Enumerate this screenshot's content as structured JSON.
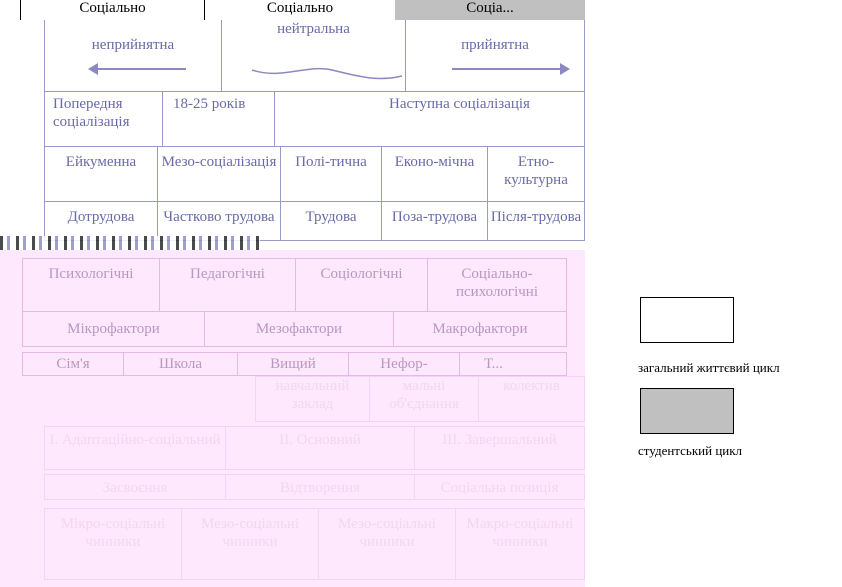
{
  "header": {
    "col1": "Соціально",
    "col2": "Соціально",
    "col3": "Соціа..."
  },
  "row_stance": [
    "неприйнятна",
    "нейтральна",
    "прийнятна"
  ],
  "row_age": {
    "previous": "Попередня соціалізація",
    "age": "18-25 років",
    "next": "Наступна соціалізація"
  },
  "row_types": [
    "Ейкуменна",
    "Мезо-соціалізація",
    "Полі-тична",
    "Еконо-мічна",
    "Етно-культурна"
  ],
  "row_work": [
    "Дотрудова",
    "Частково трудова",
    "Трудова",
    "Поза-трудова",
    "Після-трудова"
  ],
  "row_approaches": [
    "Психологічні",
    "Педагогічні",
    "Соціологічні",
    "Соціально-психологічні"
  ],
  "row_factors": [
    "Мікрофактори",
    "Мезофактори",
    "Макрофактори"
  ],
  "row_institutions": [
    "Сім'я",
    "Школа",
    "Вищий",
    "Нефор-",
    "Т..."
  ],
  "faint_row1": [
    "навчальний заклад",
    "мальні об'єднання",
    "колектив"
  ],
  "faint_row2": [
    "I. Адаптаційно-соціальний",
    "II. Основний",
    "III. Завершальний"
  ],
  "faint_row3": [
    "Засвоєння",
    "Відтворення",
    "Соціальна позиція"
  ],
  "faint_row4": [
    "Мікро-соціальні чинники",
    "Мезо-соціальні чинники",
    "Мезо-соціальні чинники",
    "Макро-соціальні чинники"
  ],
  "legend": {
    "life_cycle": "загальний життєвий цикл",
    "student_cycle": "студентський цикл"
  },
  "colors": {
    "line": "#9a9ac6",
    "text": "#6a6aa8",
    "pink": "#fde8fd",
    "gray": "#c0c0c0"
  }
}
